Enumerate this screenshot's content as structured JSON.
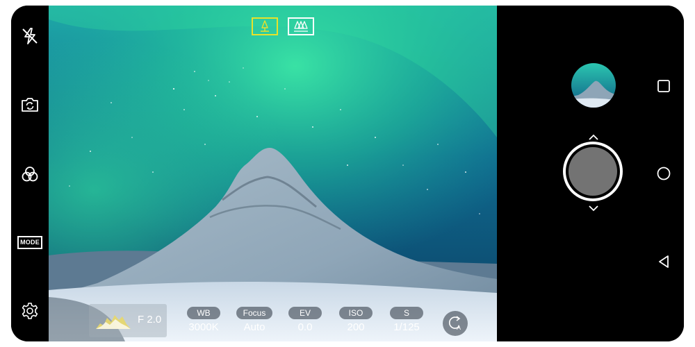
{
  "left_rail": {
    "items": [
      {
        "icon": "flash-off-icon"
      },
      {
        "icon": "switch-camera-icon"
      },
      {
        "icon": "filter-icon"
      },
      {
        "icon": "mode-icon",
        "label": "MODE"
      },
      {
        "icon": "settings-icon"
      }
    ]
  },
  "lens": {
    "options": [
      {
        "icon": "standard-lens-icon",
        "active": true
      },
      {
        "icon": "wide-lens-icon",
        "active": false
      }
    ],
    "active_color": "#e8e22a"
  },
  "manual": {
    "aperture": "F 2.0",
    "params": [
      {
        "label": "WB",
        "value": "3000K"
      },
      {
        "label": "Focus",
        "value": "Auto"
      },
      {
        "label": "EV",
        "value": "0.0"
      },
      {
        "label": "ISO",
        "value": "200"
      },
      {
        "label": "S",
        "value": "1/125"
      }
    ],
    "reset_icon": "auto-reset-icon"
  },
  "right_panel": {
    "gallery_icon": "gallery-thumbnail",
    "shutter_icon": "shutter-button",
    "nav": [
      {
        "icon": "recents-icon"
      },
      {
        "icon": "home-icon"
      },
      {
        "icon": "back-icon"
      }
    ]
  }
}
